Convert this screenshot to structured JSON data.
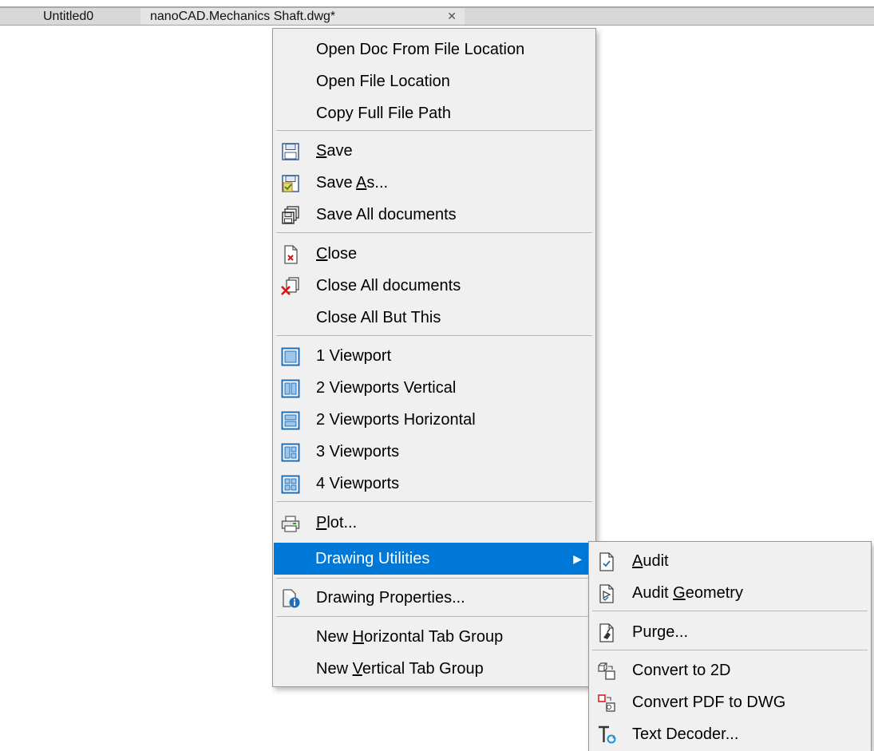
{
  "tabs": [
    {
      "label": "Untitled0"
    },
    {
      "label": "nanoCAD.Mechanics Shaft.dwg*",
      "close": "✕"
    }
  ],
  "context_menu": {
    "items": [
      {
        "label": "Open Doc From File Location"
      },
      {
        "label": "Open File Location"
      },
      {
        "label": "Copy Full File Path"
      },
      {
        "label": "Save",
        "accel_pre": "",
        "accel": "S",
        "accel_post": "ave",
        "icon": "save-icon"
      },
      {
        "label": "Save As...",
        "accel_pre": "Save ",
        "accel": "A",
        "accel_post": "s...",
        "icon": "save-as-icon"
      },
      {
        "label": "Save All documents",
        "icon": "save-all-icon"
      },
      {
        "label": "Close",
        "accel_pre": "",
        "accel": "C",
        "accel_post": "lose",
        "icon": "close-document-icon"
      },
      {
        "label": "Close All documents",
        "icon": "close-all-icon"
      },
      {
        "label": "Close All But This"
      },
      {
        "label": "1 Viewport",
        "icon": "one-viewport-icon"
      },
      {
        "label": "2 Viewports Vertical",
        "icon": "two-viewports-vertical-icon"
      },
      {
        "label": "2 Viewports Horizontal",
        "icon": "two-viewports-horizontal-icon"
      },
      {
        "label": "3 Viewports",
        "icon": "three-viewports-icon"
      },
      {
        "label": "4 Viewports",
        "icon": "four-viewports-icon"
      },
      {
        "label": "Plot...",
        "accel_pre": "",
        "accel": "P",
        "accel_post": "lot...",
        "icon": "printer-icon"
      },
      {
        "label": "Drawing Utilities",
        "submenu_arrow": "▶",
        "highlighted": true
      },
      {
        "label": "Drawing Properties...",
        "icon": "drawing-properties-icon"
      },
      {
        "label": "New Horizontal Tab Group",
        "accel_pre": "New ",
        "accel": "H",
        "accel_post": "orizontal Tab Group"
      },
      {
        "label": "New Vertical Tab Group",
        "accel_pre": "New ",
        "accel": "V",
        "accel_post": "ertical Tab Group"
      }
    ]
  },
  "submenu": {
    "items": [
      {
        "label": "Audit",
        "accel_pre": "",
        "accel": "A",
        "accel_post": "udit",
        "icon": "audit-icon"
      },
      {
        "label": "Audit Geometry",
        "accel_pre": "Audit ",
        "accel": "G",
        "accel_post": "eometry",
        "icon": "audit-geometry-icon"
      },
      {
        "label": "Purge...",
        "icon": "purge-icon"
      },
      {
        "label": "Convert to 2D",
        "icon": "convert-2d-icon"
      },
      {
        "label": "Convert PDF to DWG",
        "icon": "convert-pdf-icon"
      },
      {
        "label": "Text Decoder...",
        "icon": "text-decoder-icon"
      }
    ]
  },
  "colors": {
    "highlight": "#0078d7",
    "menu_bg": "#f0f0f0",
    "icon_blue": "#1e6fb8"
  }
}
